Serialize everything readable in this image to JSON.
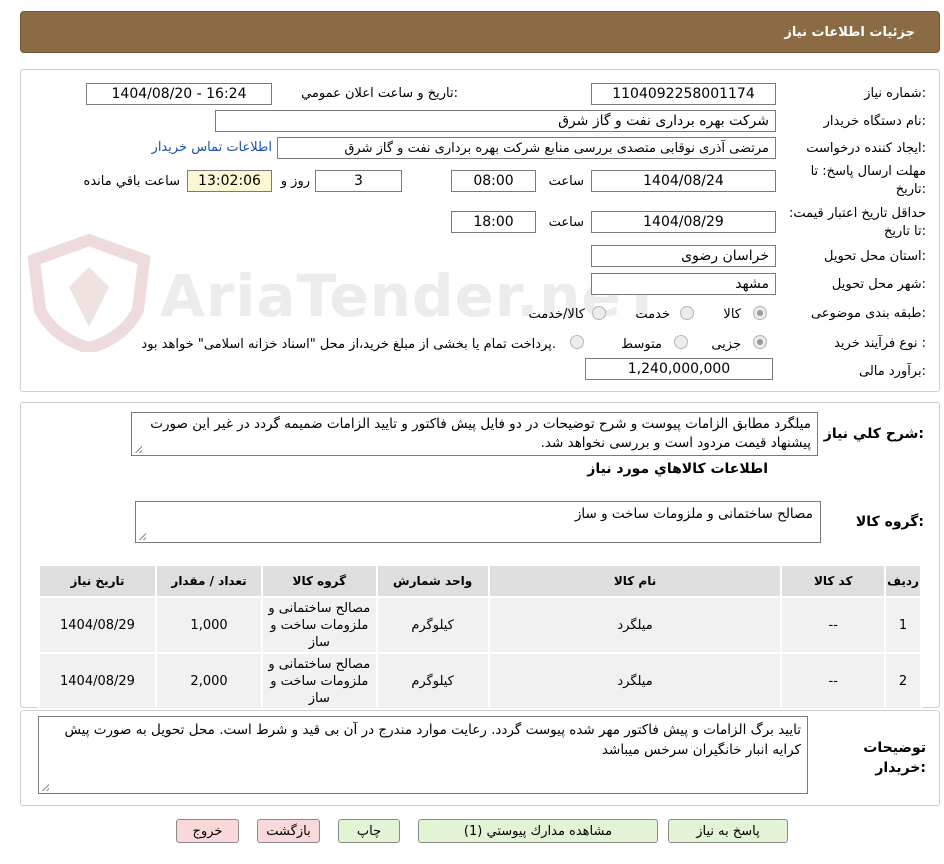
{
  "header": {
    "title": "جزئیات اطلاعات نیاز"
  },
  "watermark": {
    "text": "AriaTender.neT"
  },
  "form": {
    "need_number": {
      "label": "شماره نیاز:",
      "value": "1104092258001174"
    },
    "announce_datetime": {
      "label": "تاریخ و ساعت اعلان عمومي:",
      "value": "1404/08/20 - 16:24"
    },
    "buyer_org": {
      "label": "نام دستگاه خریدار:",
      "value": "شرکت بهره برداری نفت و گاز شرق"
    },
    "requester": {
      "label": "ایجاد کننده درخواست:",
      "value": "مرتضی آذری نوقابی متصدی بررسی منابع شرکت بهره برداری نفت و گاز شرق",
      "contact_link": "اطلاعات تماس خریدار"
    },
    "reply_deadline": {
      "label": "مهلت ارسال پاسخ: تا تاریخ:",
      "date": "1404/08/24",
      "time_label": "ساعت",
      "time": "08:00",
      "days": "3",
      "days_label": "روز و",
      "remaining": "13:02:06",
      "remaining_label": "ساعت باقي مانده"
    },
    "price_validity": {
      "label": "حداقل تاریخ اعتبار قیمت: تا تاریخ:",
      "date": "1404/08/29",
      "time_label": "ساعت",
      "time": "18:00"
    },
    "province": {
      "label": "استان محل تحویل:",
      "value": "خراسان رضوی"
    },
    "city": {
      "label": "شهر محل تحویل:",
      "value": "مشهد"
    },
    "category": {
      "label": "طبقه بندی موضوعی:",
      "options": [
        "کالا",
        "خدمت",
        "کالا/خدمت"
      ],
      "selected": "کالا"
    },
    "purchase_process": {
      "label": "نوع فرآیند خرید :",
      "options": [
        "جزیی",
        "متوسط"
      ],
      "selected": "جزیی",
      "note": "پرداخت تمام یا بخشی از مبلغ خرید،از محل \"اسناد خزانه اسلامی\" خواهد بود."
    },
    "estimate": {
      "label": "برآورد مالی:",
      "value": "1,240,000,000"
    }
  },
  "description": {
    "label": "شرح کلي نیاز:",
    "text": "میلگرد مطابق الزامات پیوست و شرح توضیحات در دو فایل پیش فاکتور و تایید الزامات ضمیمه گردد در غیر این صورت پیشنهاد قیمت مردود است و بررسی نخواهد شد."
  },
  "goods": {
    "section_title": "اطلاعات کالاهاي مورد نیاز",
    "group_label": "گروه کالا:",
    "group_value": "مصالح ساختمانی و ملزومات ساخت و ساز",
    "table": {
      "headers": [
        "ردیف",
        "کد کالا",
        "نام کالا",
        "واحد شمارش",
        "گروه کالا",
        "تعداد / مقدار",
        "تاریخ نیاز"
      ],
      "rows": [
        [
          "1",
          "--",
          "میلگرد",
          "کیلوگرم",
          "مصالح ساختمانی و ملزومات ساخت و ساز",
          "1,000",
          "1404/08/29"
        ],
        [
          "2",
          "--",
          "میلگرد",
          "کیلوگرم",
          "مصالح ساختمانی و ملزومات ساخت و ساز",
          "2,000",
          "1404/08/29"
        ]
      ]
    }
  },
  "buyer_notes": {
    "label": "توضیحات خریدار:",
    "text": "تایید برگ الزامات و پیش فاکتور مهر شده پیوست گردد.  رعایت موارد مندرج در آن بی قید و شرط است. محل تحویل به صورت پیش کرایه انبار خانگیران سرخس میباشد"
  },
  "buttons": {
    "reply": "پاسخ به نیاز",
    "attachments": "مشاهده مدارك پیوستي (1)",
    "print": "چاپ",
    "back": "بازگشت",
    "exit": "خروج"
  }
}
